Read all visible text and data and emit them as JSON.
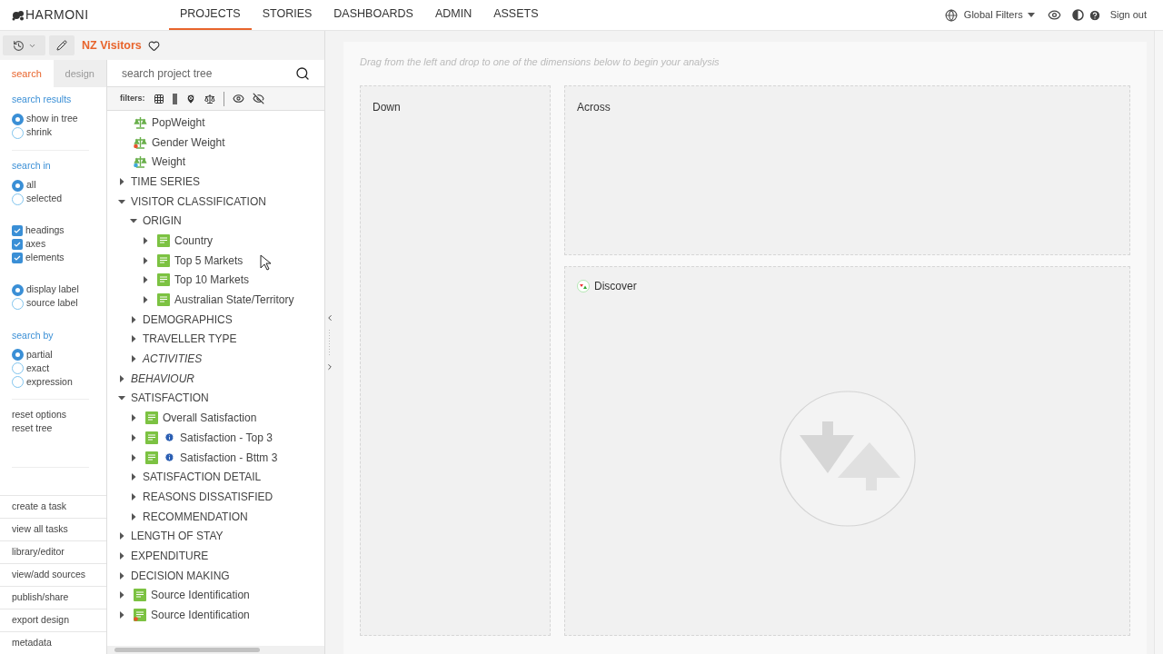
{
  "brand": "HARMONI",
  "nav": [
    {
      "label": "PROJECTS",
      "selected": true
    },
    {
      "label": "STORIES",
      "selected": false
    },
    {
      "label": "DASHBOARDS",
      "selected": false
    },
    {
      "label": "ADMIN",
      "selected": false
    },
    {
      "label": "ASSETS",
      "selected": false
    }
  ],
  "global_filters": "Global Filters",
  "sign_out": "Sign out",
  "project_title": "NZ Visitors",
  "side_tabs": [
    {
      "label": "search",
      "selected": true
    },
    {
      "label": "design",
      "selected": false
    }
  ],
  "option_groups": [
    {
      "heading": "search results",
      "items": [
        {
          "kind": "radio",
          "label": "show in tree",
          "checked": true
        },
        {
          "kind": "radio",
          "label": "shrink",
          "checked": false
        }
      ]
    },
    {
      "heading": "search in",
      "items": [
        {
          "kind": "radio",
          "label": "all",
          "checked": true
        },
        {
          "kind": "radio",
          "label": "selected",
          "checked": false
        }
      ]
    },
    {
      "items": [
        {
          "kind": "checkbox",
          "label": "headings",
          "checked": true
        },
        {
          "kind": "checkbox",
          "label": "axes",
          "checked": true
        },
        {
          "kind": "checkbox",
          "label": "elements",
          "checked": true
        }
      ]
    },
    {
      "items": [
        {
          "kind": "radio",
          "label": "display label",
          "checked": true
        },
        {
          "kind": "radio",
          "label": "source label",
          "checked": false
        }
      ]
    },
    {
      "heading": "search by",
      "items": [
        {
          "kind": "radio",
          "label": "partial",
          "checked": true
        },
        {
          "kind": "radio",
          "label": "exact",
          "checked": false
        },
        {
          "kind": "radio",
          "label": "expression",
          "checked": false
        }
      ]
    }
  ],
  "reset_links": [
    "reset options",
    "reset tree"
  ],
  "bottom_links": [
    "create a task",
    "view all tasks",
    "library/editor",
    "view/add sources",
    "publish/share",
    "export design",
    "metadata"
  ],
  "search": {
    "placeholder": "search project tree"
  },
  "filters_label": "filters:",
  "tree": [
    {
      "kind": "weight",
      "label": "PopWeight"
    },
    {
      "kind": "weight",
      "label": "Gender Weight",
      "color": "#e8542c"
    },
    {
      "kind": "weight",
      "label": "Weight",
      "color": "#3fa9d8"
    },
    {
      "kind": "folder",
      "label": "TIME SERIES",
      "expanded": false,
      "italic": false
    },
    {
      "kind": "folder",
      "label": "VISITOR CLASSIFICATION",
      "expanded": true,
      "italic": false,
      "children": [
        {
          "kind": "folder",
          "label": "ORIGIN",
          "expanded": true,
          "italic": false,
          "children": [
            {
              "kind": "list",
              "label": "Country",
              "expanded": false,
              "info": false
            },
            {
              "kind": "list",
              "label": "Top 5 Markets",
              "expanded": false,
              "info": false
            },
            {
              "kind": "list",
              "label": "Top 10 Markets",
              "expanded": false,
              "info": false
            },
            {
              "kind": "list",
              "label": "Australian State/Territory",
              "expanded": false,
              "info": false
            }
          ]
        },
        {
          "kind": "folder",
          "label": "DEMOGRAPHICS",
          "expanded": false,
          "italic": false
        },
        {
          "kind": "folder",
          "label": "TRAVELLER TYPE",
          "expanded": false,
          "italic": false
        },
        {
          "kind": "folder",
          "label": "ACTIVITIES",
          "expanded": false,
          "italic": true
        }
      ]
    },
    {
      "kind": "folder",
      "label": "BEHAVIOUR",
      "expanded": false,
      "italic": true
    },
    {
      "kind": "folder",
      "label": "SATISFACTION",
      "expanded": true,
      "italic": false,
      "children": [
        {
          "kind": "list",
          "label": "Overall Satisfaction",
          "expanded": false,
          "info": false
        },
        {
          "kind": "list",
          "label": "Satisfaction - Top 3",
          "expanded": false,
          "info": true
        },
        {
          "kind": "list",
          "label": "Satisfaction - Bttm 3",
          "expanded": false,
          "info": true
        },
        {
          "kind": "folder",
          "label": "SATISFACTION DETAIL",
          "expanded": false,
          "italic": false
        },
        {
          "kind": "folder",
          "label": "REASONS DISSATISFIED",
          "expanded": false,
          "italic": false
        },
        {
          "kind": "folder",
          "label": "RECOMMENDATION",
          "expanded": false,
          "italic": false
        }
      ]
    },
    {
      "kind": "folder",
      "label": "LENGTH OF STAY",
      "expanded": false,
      "italic": false
    },
    {
      "kind": "folder",
      "label": "EXPENDITURE",
      "expanded": false,
      "italic": false
    },
    {
      "kind": "folder",
      "label": "DECISION MAKING",
      "expanded": false,
      "italic": false
    },
    {
      "kind": "list",
      "label": "Source Identification",
      "expanded": false,
      "info": false
    },
    {
      "kind": "list",
      "label": "Source Identification",
      "color": "#e8542c",
      "expanded": false,
      "info": false
    }
  ],
  "hint": "Drag from the left and drop to one of the dimensions below to begin your analysis",
  "drop_zones": {
    "down": "Down",
    "across": "Across",
    "discover": "Discover"
  }
}
